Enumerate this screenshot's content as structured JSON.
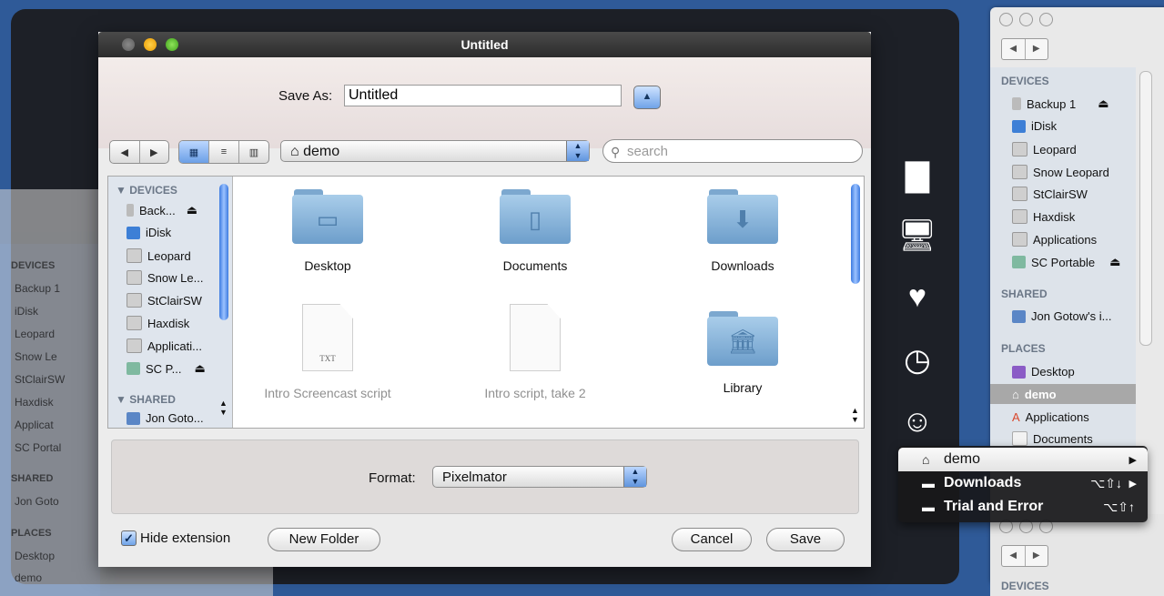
{
  "dialog": {
    "title": "Untitled",
    "save_as_label": "Save As:",
    "save_as_value": "Untitled",
    "location": "demo",
    "search_placeholder": "search",
    "format_label": "Format:",
    "format_value": "Pixelmator",
    "hide_extension_label": "Hide extension",
    "hide_extension_checked": true,
    "new_folder_label": "New Folder",
    "cancel_label": "Cancel",
    "save_label": "Save"
  },
  "sidebar": {
    "devices_header": "DEVICES",
    "devices": [
      "Back...",
      "iDisk",
      "Leopard",
      "Snow Le...",
      "StClairSW",
      "Haxdisk",
      "Applicati...",
      "SC P..."
    ],
    "shared_header": "SHARED",
    "shared": [
      "Jon Goto..."
    ]
  },
  "files": [
    {
      "label": "Desktop",
      "kind": "folder",
      "icon": "desktop-folder-icon",
      "dimmed": false
    },
    {
      "label": "Documents",
      "kind": "folder",
      "icon": "documents-folder-icon",
      "dimmed": false
    },
    {
      "label": "Downloads",
      "kind": "folder",
      "icon": "downloads-folder-icon",
      "dimmed": false
    },
    {
      "label": "Intro Screencast script",
      "kind": "document",
      "ext": "TXT",
      "icon": "txt-file-icon",
      "dimmed": true
    },
    {
      "label": "Intro script, take 2",
      "kind": "document",
      "ext": "",
      "icon": "blank-file-icon",
      "dimmed": true
    },
    {
      "label": "Library",
      "kind": "folder",
      "icon": "library-folder-icon",
      "dimmed": false
    }
  ],
  "finder_right": {
    "devices_header": "DEVICES",
    "devices": [
      "Backup 1",
      "iDisk",
      "Leopard",
      "Snow Leopard",
      "StClairSW",
      "Haxdisk",
      "Applications",
      "SC Portable"
    ],
    "shared_header": "SHARED",
    "shared": [
      "Jon Gotow's i..."
    ],
    "places_header": "PLACES",
    "places": [
      "Desktop",
      "demo",
      "Applications",
      "Documents"
    ],
    "selected_place": "demo",
    "bottom_devices_header": "DEVICES"
  },
  "ghost_finder": {
    "devices_header": "DEVICES",
    "devices": [
      "Backup 1",
      "iDisk",
      "Leopard",
      "Snow Le",
      "StClairSW",
      "Haxdisk",
      "Applicat",
      "SC Portal"
    ],
    "shared_header": "SHARED",
    "shared": [
      "Jon Goto"
    ],
    "places_header": "PLACES",
    "places": [
      "Desktop",
      "demo"
    ]
  },
  "menu": {
    "items": [
      {
        "label": "demo",
        "shortcut": "",
        "submenu": true
      },
      {
        "label": "Downloads",
        "shortcut": "⌥⇧↓",
        "submenu": true
      },
      {
        "label": "Trial and Error",
        "shortcut": "⌥⇧↑",
        "submenu": false
      }
    ]
  },
  "side_icons": [
    "documents-icon",
    "computer-icon",
    "favorites-heart-icon",
    "recent-clock-icon",
    "finder-icon"
  ],
  "colors": {
    "accent": "#5f94de",
    "desktop": "#2f5a98",
    "hud": "#1d2027"
  }
}
